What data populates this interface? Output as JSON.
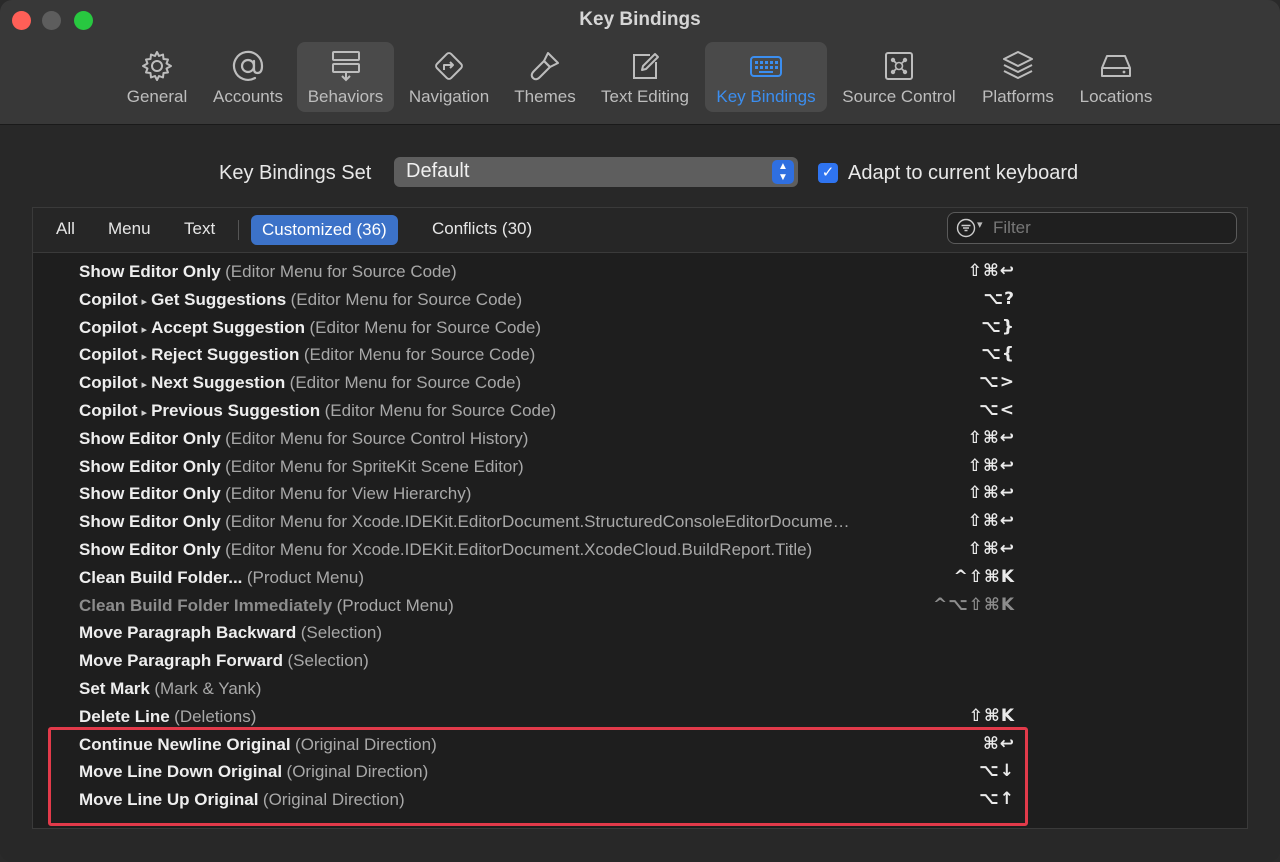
{
  "window": {
    "title": "Key Bindings"
  },
  "toolbar": [
    {
      "label": "General",
      "icon": "gear-icon"
    },
    {
      "label": "Accounts",
      "icon": "at-icon"
    },
    {
      "label": "Behaviors",
      "icon": "behaviors-icon"
    },
    {
      "label": "Navigation",
      "icon": "navigation-icon"
    },
    {
      "label": "Themes",
      "icon": "brush-icon"
    },
    {
      "label": "Text Editing",
      "icon": "pencil-square-icon"
    },
    {
      "label": "Key Bindings",
      "icon": "keyboard-icon"
    },
    {
      "label": "Source Control",
      "icon": "source-control-icon"
    },
    {
      "label": "Platforms",
      "icon": "layers-icon"
    },
    {
      "label": "Locations",
      "icon": "drive-icon"
    }
  ],
  "settings": {
    "set_label": "Key Bindings Set",
    "set_value": "Default",
    "adapt_label": "Adapt to current keyboard",
    "adapt_checked": true
  },
  "filters": {
    "all": "All",
    "menu": "Menu",
    "text": "Text",
    "customized": "Customized (36)",
    "conflicts": "Conflicts (30)",
    "search_placeholder": "Filter"
  },
  "rows": [
    {
      "cmd": "Show Editor Only",
      "ctx": "(Editor Menu for Source Code)",
      "key": "⇧⌘↩"
    },
    {
      "cmd_a": "Copilot",
      "cmd_b": "Get Suggestions",
      "ctx": "(Editor Menu for Source Code)",
      "key": "⌥?"
    },
    {
      "cmd_a": "Copilot",
      "cmd_b": "Accept Suggestion",
      "ctx": "(Editor Menu for Source Code)",
      "key": "⌥}"
    },
    {
      "cmd_a": "Copilot",
      "cmd_b": "Reject Suggestion",
      "ctx": "(Editor Menu for Source Code)",
      "key": "⌥{"
    },
    {
      "cmd_a": "Copilot",
      "cmd_b": "Next Suggestion",
      "ctx": "(Editor Menu for Source Code)",
      "key": "⌥>"
    },
    {
      "cmd_a": "Copilot",
      "cmd_b": "Previous Suggestion",
      "ctx": "(Editor Menu for Source Code)",
      "key": "⌥<"
    },
    {
      "cmd": "Show Editor Only",
      "ctx": "(Editor Menu for Source Control History)",
      "key": "⇧⌘↩"
    },
    {
      "cmd": "Show Editor Only",
      "ctx": "(Editor Menu for SpriteKit Scene Editor)",
      "key": "⇧⌘↩"
    },
    {
      "cmd": "Show Editor Only",
      "ctx": "(Editor Menu for View Hierarchy)",
      "key": "⇧⌘↩"
    },
    {
      "cmd": "Show Editor Only",
      "ctx": "(Editor Menu for Xcode.IDEKit.EditorDocument.StructuredConsoleEditorDocume…",
      "key": "⇧⌘↩"
    },
    {
      "cmd": "Show Editor Only",
      "ctx": "(Editor Menu for Xcode.IDEKit.EditorDocument.XcodeCloud.BuildReport.Title)",
      "key": "⇧⌘↩"
    },
    {
      "cmd": "Clean Build Folder...",
      "ctx": "(Product Menu)",
      "key": "^⇧⌘K"
    },
    {
      "cmd": "Clean Build Folder Immediately",
      "ctx": "(Product Menu)",
      "key": "^⌥⇧⌘K",
      "dim": true
    },
    {
      "cmd": "Move Paragraph Backward",
      "ctx": "(Selection)",
      "key": ""
    },
    {
      "cmd": "Move Paragraph Forward",
      "ctx": "(Selection)",
      "key": ""
    },
    {
      "cmd": "Set Mark",
      "ctx": "(Mark & Yank)",
      "key": ""
    },
    {
      "cmd": "Delete Line",
      "ctx": "(Deletions)",
      "key": "⇧⌘K"
    },
    {
      "cmd": "Continue Newline Original",
      "ctx": "(Original Direction)",
      "key": "⌘↩"
    },
    {
      "cmd": "Move Line Down Original",
      "ctx": "(Original Direction)",
      "key": "⌥↓"
    },
    {
      "cmd": "Move Line Up Original",
      "ctx": "(Original Direction)",
      "key": "⌥↑"
    }
  ],
  "colors": {
    "accent": "#3b8ef0",
    "highlight_box": "#e23a4a",
    "close": "#ff5f57",
    "maximize": "#28c840"
  }
}
